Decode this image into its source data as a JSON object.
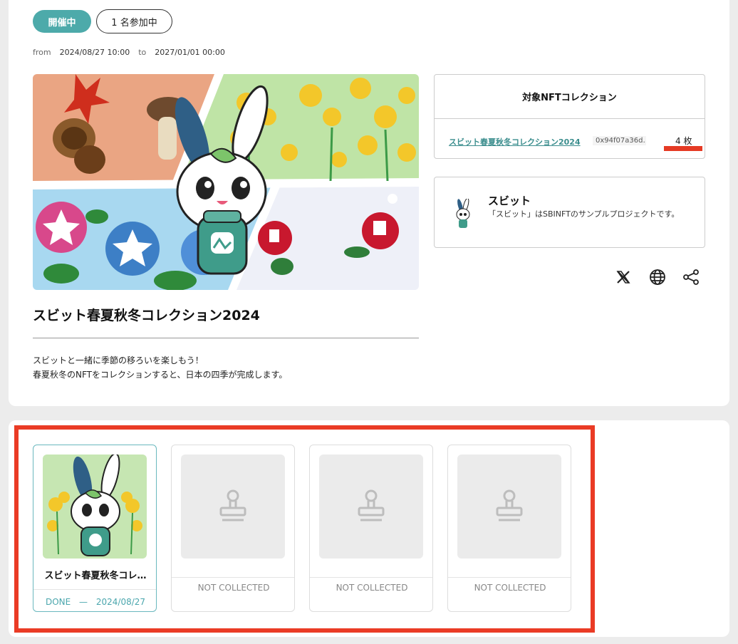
{
  "event": {
    "status_badge": "開催中",
    "participants": "1 名参加中",
    "from_label": "from",
    "from_date": "2024/08/27 10:00",
    "to_label": "to",
    "to_date": "2027/01/01 00:00",
    "title": "スビット春夏秋冬コレクション2024",
    "description_line1": "スビットと一緒に季節の移ろいを楽しもう！",
    "description_line2": "春夏秋冬のNFTをコレクションすると、日本の四季が完成します。"
  },
  "collection": {
    "heading": "対象NFTコレクション",
    "name": "スビット春夏秋冬コレクション2024",
    "address": "0x94f07a36d…",
    "quantity": "4 枚"
  },
  "project": {
    "name": "スビット",
    "description": "「スビット」はSBINFTのサンプルプロジェクトです。"
  },
  "share_icons": [
    "x-logo-icon",
    "globe-icon",
    "share-icon"
  ],
  "stamps": [
    {
      "name": "スビット春夏秋冬コレ…",
      "status": "DONE",
      "date": "2024/08/27",
      "collected": true
    },
    {
      "name": "",
      "status": "NOT COLLECTED",
      "collected": false
    },
    {
      "name": "",
      "status": "NOT COLLECTED",
      "collected": false
    },
    {
      "name": "",
      "status": "NOT COLLECTED",
      "collected": false
    }
  ],
  "colors": {
    "accent": "#4daaaa",
    "highlight_red": "#ea3b25",
    "link": "#3a8d8d"
  }
}
